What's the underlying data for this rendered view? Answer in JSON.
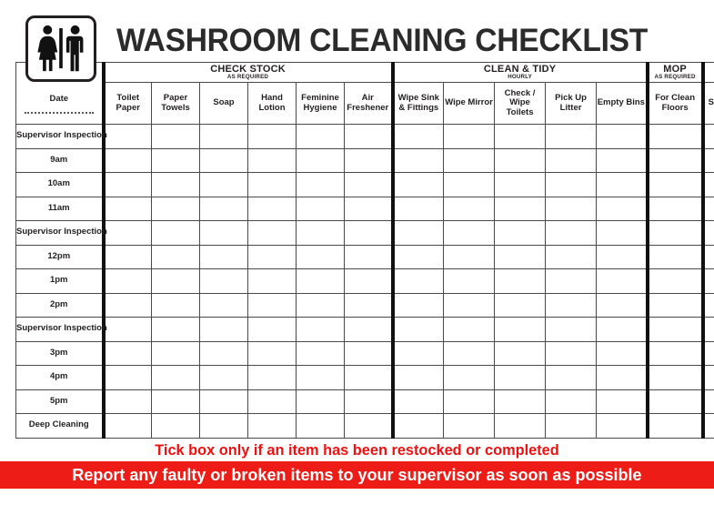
{
  "header": {
    "title": "WASHROOM CLEANING CHECKLIST",
    "sign_icon": "washroom-male-female-icon"
  },
  "table": {
    "date_column": {
      "label": "Date",
      "has_write_line": true
    },
    "groups": [
      {
        "title": "CHECK STOCK",
        "subtitle": "AS REQUIRED",
        "span": 6
      },
      {
        "title": "CLEAN & TIDY",
        "subtitle": "HOURLY",
        "span": 5
      },
      {
        "title": "MOP",
        "subtitle": "AS REQUIRED",
        "span": 1
      },
      {
        "title": "",
        "subtitle": "",
        "span": 1
      }
    ],
    "columns": [
      "Toilet Paper",
      "Paper Towels",
      "Soap",
      "Hand Lotion",
      "Feminine Hygiene",
      "Air Freshener",
      "Wipe Sink & Fittings",
      "Wipe Mirror",
      "Check / Wipe Toilets",
      "Pick Up Litter",
      "Empty Bins",
      "For Clean Floors",
      "Signed by"
    ],
    "rows": [
      "Supervisor Inspection",
      "9am",
      "10am",
      "11am",
      "Supervisor Inspection",
      "12pm",
      "1pm",
      "2pm",
      "Supervisor Inspection",
      "3pm",
      "4pm",
      "5pm",
      "Deep Cleaning"
    ]
  },
  "notices": {
    "tick_note": "Tick box only if an item has been restocked or completed",
    "report_note": "Report any faulty or broken items to your supervisor as soon as possible"
  },
  "colors": {
    "red_text": "#ee1111",
    "red_bar": "#ed1c16",
    "header_cream": "#fbeee6",
    "group_gray": "#eeeeee"
  }
}
